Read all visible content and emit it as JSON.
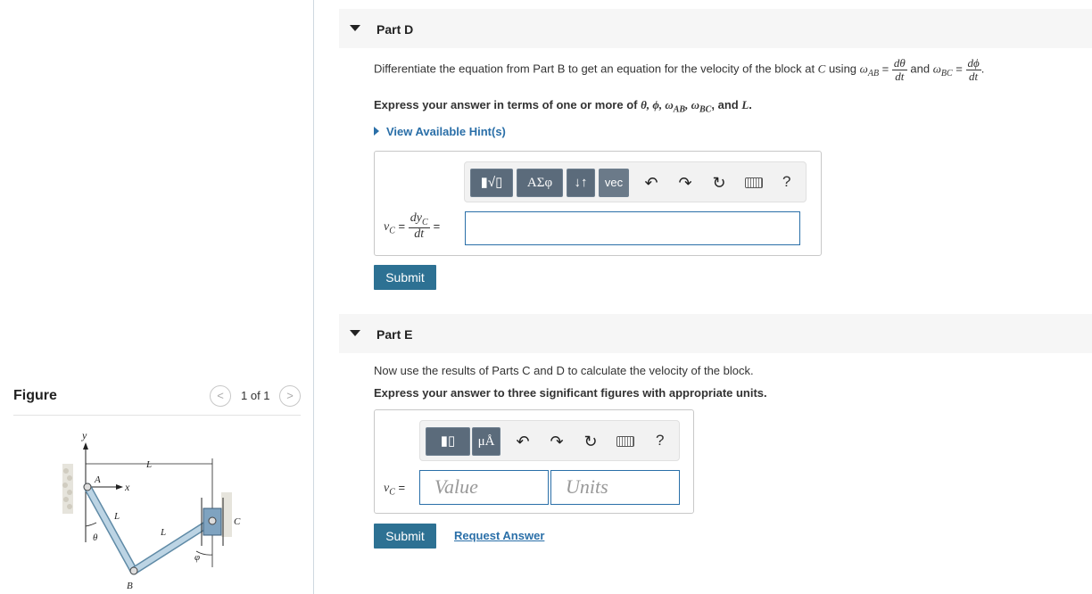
{
  "figure": {
    "title": "Figure",
    "pager_prev": "<",
    "pager_next": ">",
    "pager_count": "1 of 1",
    "labels": {
      "y": "y",
      "x": "x",
      "A": "A",
      "B": "B",
      "C": "C",
      "L_top": "L",
      "L_ab": "L",
      "L_bc": "L",
      "theta": "θ",
      "phi": "φ"
    }
  },
  "partD": {
    "title": "Part D",
    "question_pre": "Differentiate the equation from Part B to get an equation for the velocity of the block at ",
    "question_C": "C",
    "question_using": " using ",
    "omega_ab": "ω",
    "sub_ab": "AB",
    "eq": " = ",
    "frac1_num": "dθ",
    "frac1_den": "dt",
    "and": " and ",
    "omega_bc": "ω",
    "sub_bc": "BC",
    "frac2_num": "dϕ",
    "frac2_den": "dt",
    "period": ".",
    "express_pre": "Express your answer in terms of one or more of ",
    "express_vars": "θ, ϕ, ω",
    "express_sub_ab": "AB",
    "express_comma": ", ω",
    "express_sub_bc": "BC",
    "express_and": ", and ",
    "express_L": "L",
    "express_end": ".",
    "hint_label": "View Available Hint(s)",
    "toolbar": {
      "templates": "▮√▯",
      "greek": "ΑΣφ",
      "arrows": "↓↑",
      "vec": "vec",
      "undo": "↶",
      "redo": "↷",
      "reset": "↻",
      "help": "?"
    },
    "lhs_v": "v",
    "lhs_sub": "C",
    "lhs_eq": " = ",
    "lhs_num_d": "dy",
    "lhs_num_sub": "C",
    "lhs_den": "dt",
    "lhs_eq2": "=",
    "answer_value": "",
    "submit_label": "Submit"
  },
  "partE": {
    "title": "Part E",
    "question": "Now use the results of Parts C and D to calculate the velocity of the block.",
    "express": "Express your answer to three significant figures with appropriate units.",
    "toolbar": {
      "templates": "▮▯",
      "units": "μÅ",
      "undo": "↶",
      "redo": "↷",
      "reset": "↻",
      "help": "?"
    },
    "lhs_v": "v",
    "lhs_sub": "C",
    "lhs_eq": " =",
    "value_placeholder": "Value",
    "units_placeholder": "Units",
    "submit_label": "Submit",
    "request_answer": "Request Answer"
  }
}
